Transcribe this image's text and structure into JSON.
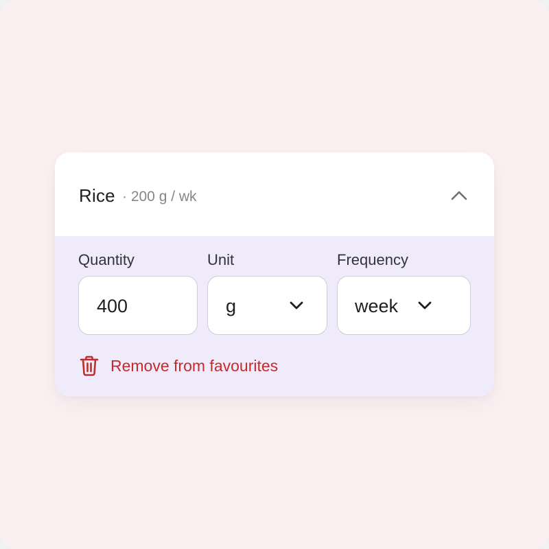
{
  "item": {
    "name": "Rice",
    "summary": "· 200 g / wk",
    "expanded": true,
    "collapse_icon": "chevron-up-icon"
  },
  "fields": {
    "quantity": {
      "label": "Quantity",
      "value": "400"
    },
    "unit": {
      "label": "Unit",
      "value": "g",
      "icon": "chevron-down-icon"
    },
    "frequency": {
      "label": "Frequency",
      "value": "week",
      "icon": "chevron-down-icon"
    }
  },
  "remove": {
    "label": "Remove from favourites",
    "icon": "trash-icon"
  },
  "colors": {
    "page_background": "#fbf1f2",
    "card_background": "#ffffff",
    "panel_background": "#efebfa",
    "danger": "#c42b2b",
    "muted_text": "#86848d",
    "field_border": "#cfccd8"
  }
}
